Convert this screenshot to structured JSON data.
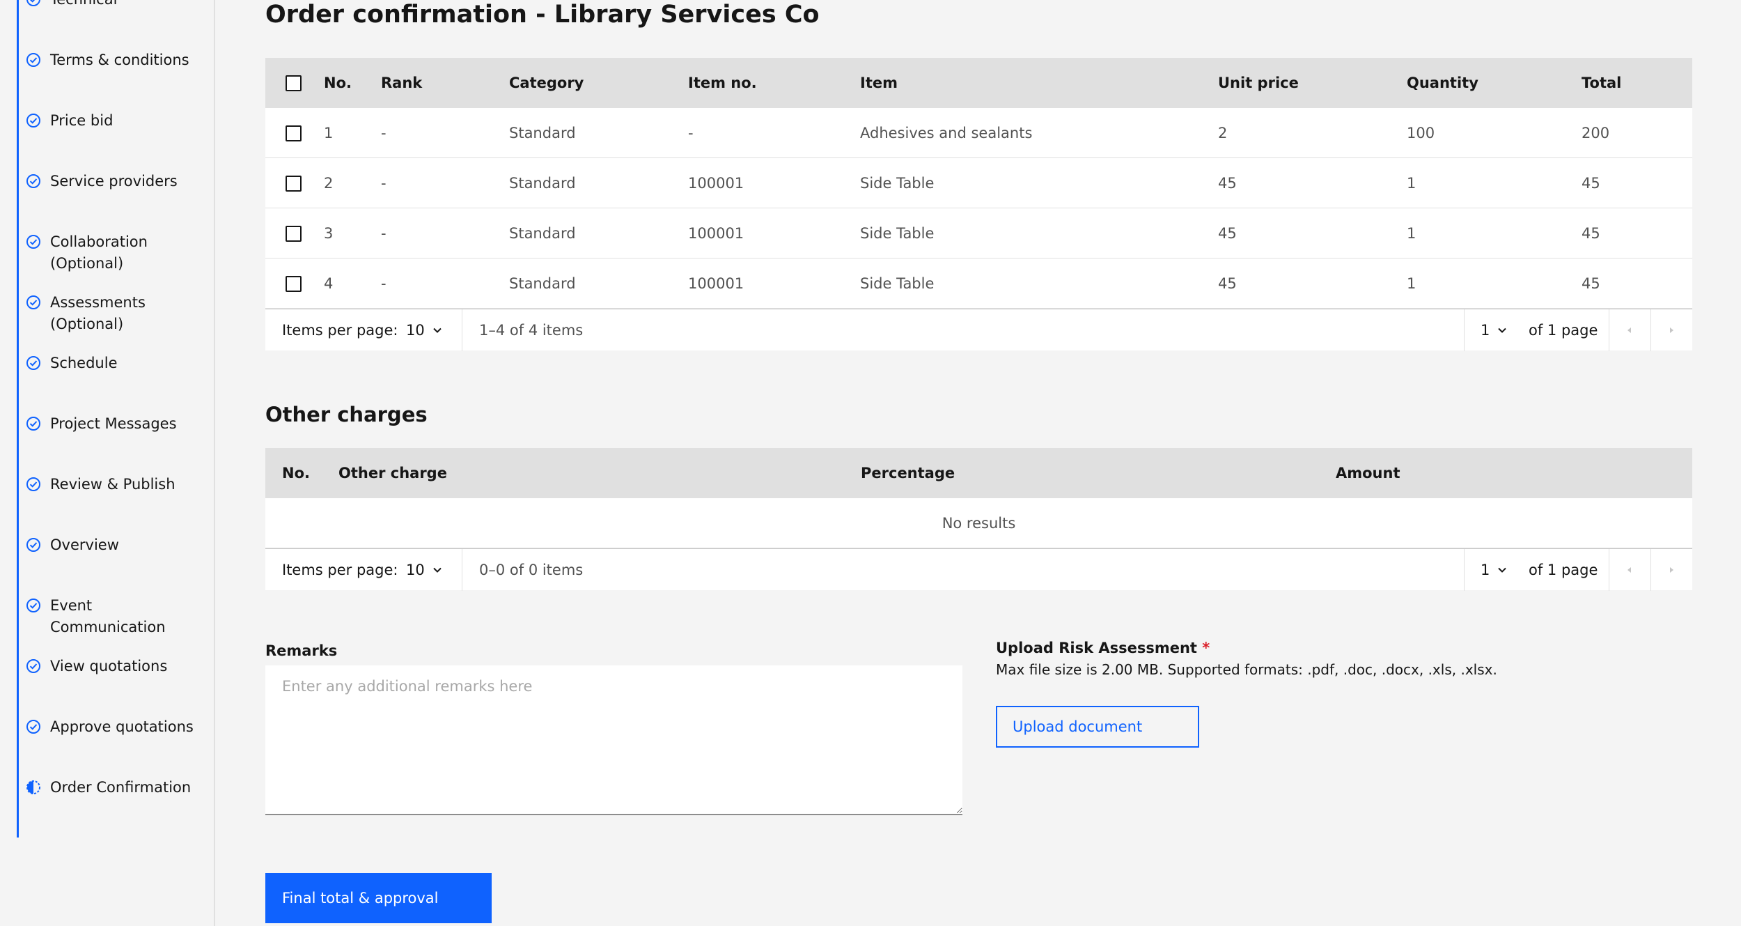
{
  "sidebar": {
    "items": [
      {
        "label": "Technical",
        "status": "complete"
      },
      {
        "label": "Terms & conditions",
        "status": "complete"
      },
      {
        "label": "Price bid",
        "status": "complete"
      },
      {
        "label": "Service providers",
        "status": "complete"
      },
      {
        "label": "Collaboration (Optional)",
        "status": "complete"
      },
      {
        "label": "Assessments (Optional)",
        "status": "complete"
      },
      {
        "label": "Schedule",
        "status": "complete"
      },
      {
        "label": "Project Messages",
        "status": "complete"
      },
      {
        "label": "Review & Publish",
        "status": "complete"
      },
      {
        "label": "Overview",
        "status": "complete"
      },
      {
        "label": "Event Communication",
        "status": "complete"
      },
      {
        "label": "View quotations",
        "status": "complete"
      },
      {
        "label": "Approve quotations",
        "status": "complete"
      },
      {
        "label": "Order Confirmation",
        "status": "current"
      }
    ]
  },
  "page": {
    "title": "Order confirmation - Library Services Co"
  },
  "items_table": {
    "headers": [
      "No.",
      "Rank",
      "Category",
      "Item no.",
      "Item",
      "Unit price",
      "Quantity",
      "Total"
    ],
    "rows": [
      [
        "1",
        "-",
        "Standard",
        "-",
        "Adhesives and sealants",
        "2",
        "100",
        "200"
      ],
      [
        "2",
        "-",
        "Standard",
        "100001",
        "Side Table",
        "45",
        "1",
        "45"
      ],
      [
        "3",
        "-",
        "Standard",
        "100001",
        "Side Table",
        "45",
        "1",
        "45"
      ],
      [
        "4",
        "-",
        "Standard",
        "100001",
        "Side Table",
        "45",
        "1",
        "45"
      ]
    ],
    "pager": {
      "items_per_page_label": "Items per page:",
      "items_per_page": "10",
      "range": "1–4 of 4 items",
      "page": "1",
      "of_pages": "of 1 page"
    }
  },
  "other_charges": {
    "title": "Other charges",
    "headers": [
      "No.",
      "Other charge",
      "Percentage",
      "Amount"
    ],
    "empty": "No results",
    "pager": {
      "items_per_page_label": "Items per page:",
      "items_per_page": "10",
      "range": "0–0 of 0 items",
      "page": "1",
      "of_pages": "of 1 page"
    }
  },
  "remarks": {
    "label": "Remarks",
    "placeholder": "Enter any additional remarks here",
    "value": ""
  },
  "upload": {
    "title": "Upload Risk Assessment",
    "required_mark": "*",
    "help": "Max file size is 2.00 MB. Supported formats: .pdf, .doc, .docx, .xls, .xlsx.",
    "button_label": "Upload document"
  },
  "actions": {
    "final_label": "Final total & approval"
  },
  "colors": {
    "accent": "#0f62fe",
    "required": "#da1e28",
    "header_bg": "#e0e0e0",
    "page_bg": "#f4f4f4"
  }
}
